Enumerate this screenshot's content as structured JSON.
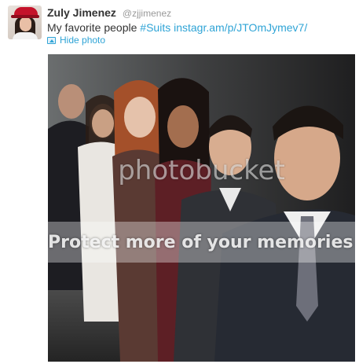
{
  "tweet": {
    "fullname": "Zuly Jimenez",
    "username": "@zjjimenez",
    "text_prefix": "My favorite people ",
    "hashtag": "#Suits",
    "link": "instagr.am/p/JTOmJymev7/",
    "hide_photo_label": "Hide photo"
  },
  "photo": {
    "watermark_main": "photobucket",
    "watermark_band": "Protect more of your memories for less!"
  },
  "colors": {
    "link": "#2fa4d6",
    "text": "#333333",
    "muted": "#999999"
  },
  "icons": {
    "hide_photo": "photo-icon"
  }
}
